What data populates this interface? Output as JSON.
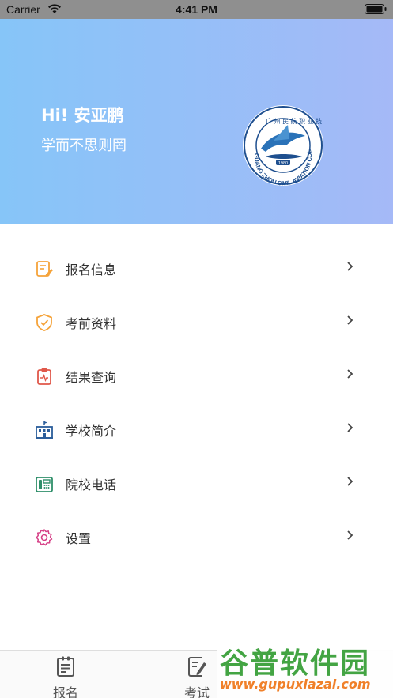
{
  "status_bar": {
    "carrier": "Carrier",
    "time": "4:41 PM"
  },
  "header": {
    "greeting": "Hi! 安亚鹏",
    "motto": "学而不思则罔",
    "logo": {
      "ring_text": "GUANG ZHOU CIVIL AVIATION COLLEGE",
      "year": "1980",
      "name_cn": "广州民航职业技术学院"
    }
  },
  "menu": [
    {
      "label": "报名信息",
      "icon": "registration-form-icon"
    },
    {
      "label": "考前资料",
      "icon": "shield-check-icon"
    },
    {
      "label": "结果查询",
      "icon": "clipboard-icon"
    },
    {
      "label": "学校简介",
      "icon": "school-building-icon"
    },
    {
      "label": "院校电话",
      "icon": "telephone-icon"
    },
    {
      "label": "设置",
      "icon": "gear-icon"
    }
  ],
  "tabs": [
    {
      "label": "报名",
      "icon": "clipboard-list-icon"
    },
    {
      "label": "考试",
      "icon": "pencil-note-icon"
    }
  ],
  "watermark": {
    "title": "谷普软件园",
    "url": "www.gupuxlazai.com"
  },
  "colors": {
    "header_start": "#86c5f8",
    "header_end": "#a5b9f7",
    "icon_orange": "#f5a33a",
    "icon_red": "#e0584a",
    "icon_blue": "#2a5d9a",
    "icon_green": "#2f8f6a",
    "icon_pink": "#d63f86"
  }
}
